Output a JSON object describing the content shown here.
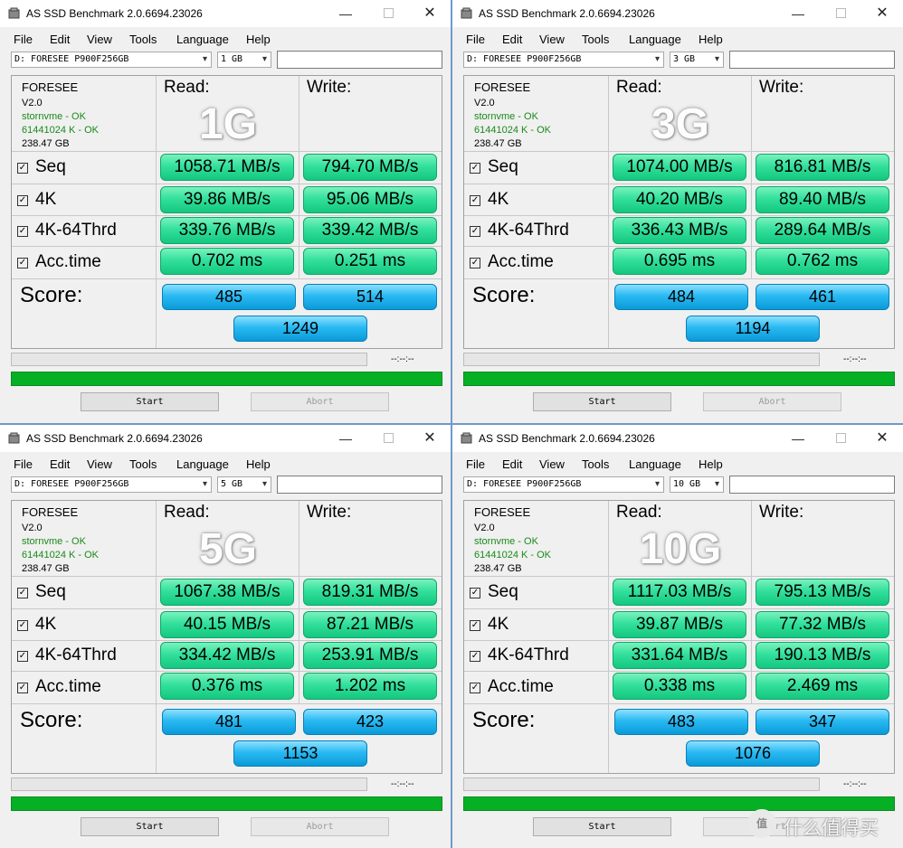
{
  "app_title": "AS SSD Benchmark 2.0.6694.23026",
  "menu": [
    "File",
    "Edit",
    "View",
    "Tools",
    "Language",
    "Help"
  ],
  "window_controls": {
    "minimize": "—",
    "close": "✕"
  },
  "drive_select": "D: FORESEE P900F256GB",
  "drive": {
    "model": "FORESEE",
    "firmware": "V2.0",
    "driver": "stornvme - OK",
    "alignment": "61441024 K - OK",
    "capacity": "238.47 GB"
  },
  "headers": {
    "read": "Read:",
    "write": "Write:",
    "score": "Score:"
  },
  "test_labels": {
    "seq": "Seq",
    "k4": "4K",
    "k4_64": "4K-64Thrd",
    "acc": "Acc.time"
  },
  "checkbox_glyph": "✓",
  "combo_arrow": "▾",
  "time_placeholder": "--:--:--",
  "buttons": {
    "start": "Start",
    "abort": "Abort"
  },
  "icons": {
    "app": "ssd-drive-icon",
    "minimize": "minimize-icon",
    "maximize": "maximize-icon",
    "close": "close-icon"
  },
  "colors": {
    "result_green": "#33e09c",
    "score_blue": "#29b9f2",
    "status_green": "#1a8a1a",
    "progress_green": "#06b025"
  },
  "windows": [
    {
      "size_select": "1 GB",
      "big_label": "1G",
      "seq": {
        "read": "1058.71 MB/s",
        "write": "794.70 MB/s"
      },
      "k4": {
        "read": "39.86 MB/s",
        "write": "95.06 MB/s"
      },
      "k4_64": {
        "read": "339.76 MB/s",
        "write": "339.42 MB/s"
      },
      "acc": {
        "read": "0.702 ms",
        "write": "0.251 ms"
      },
      "score": {
        "read": "485",
        "write": "514",
        "total": "1249"
      }
    },
    {
      "size_select": "3 GB",
      "big_label": "3G",
      "seq": {
        "read": "1074.00 MB/s",
        "write": "816.81 MB/s"
      },
      "k4": {
        "read": "40.20 MB/s",
        "write": "89.40 MB/s"
      },
      "k4_64": {
        "read": "336.43 MB/s",
        "write": "289.64 MB/s"
      },
      "acc": {
        "read": "0.695 ms",
        "write": "0.762 ms"
      },
      "score": {
        "read": "484",
        "write": "461",
        "total": "1194"
      }
    },
    {
      "size_select": "5 GB",
      "big_label": "5G",
      "seq": {
        "read": "1067.38 MB/s",
        "write": "819.31 MB/s"
      },
      "k4": {
        "read": "40.15 MB/s",
        "write": "87.21 MB/s"
      },
      "k4_64": {
        "read": "334.42 MB/s",
        "write": "253.91 MB/s"
      },
      "acc": {
        "read": "0.376 ms",
        "write": "1.202 ms"
      },
      "score": {
        "read": "481",
        "write": "423",
        "total": "1153"
      }
    },
    {
      "size_select": "10 GB",
      "big_label": "10G",
      "seq": {
        "read": "1117.03 MB/s",
        "write": "795.13 MB/s"
      },
      "k4": {
        "read": "39.87 MB/s",
        "write": "77.32 MB/s"
      },
      "k4_64": {
        "read": "331.64 MB/s",
        "write": "190.13 MB/s"
      },
      "acc": {
        "read": "0.338 ms",
        "write": "2.469 ms"
      },
      "score": {
        "read": "483",
        "write": "347",
        "total": "1076"
      }
    }
  ],
  "watermark": {
    "logo": "值",
    "text": "什么值得买"
  }
}
